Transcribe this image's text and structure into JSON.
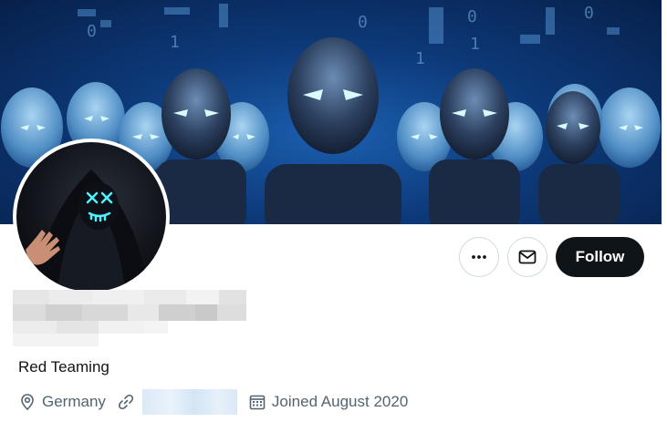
{
  "profile": {
    "bio": "Red Teaming",
    "location": "Germany",
    "joined": "Joined August 2020"
  },
  "actions": {
    "more_icon": "more-horizontal-icon",
    "message_icon": "envelope-icon",
    "follow_label": "Follow"
  },
  "icons": {
    "location": "map-pin-icon",
    "link": "link-icon",
    "calendar": "calendar-icon"
  },
  "colors": {
    "follow_bg": "#0f1419",
    "secondary_text": "#536471",
    "border": "#cfd9de"
  }
}
